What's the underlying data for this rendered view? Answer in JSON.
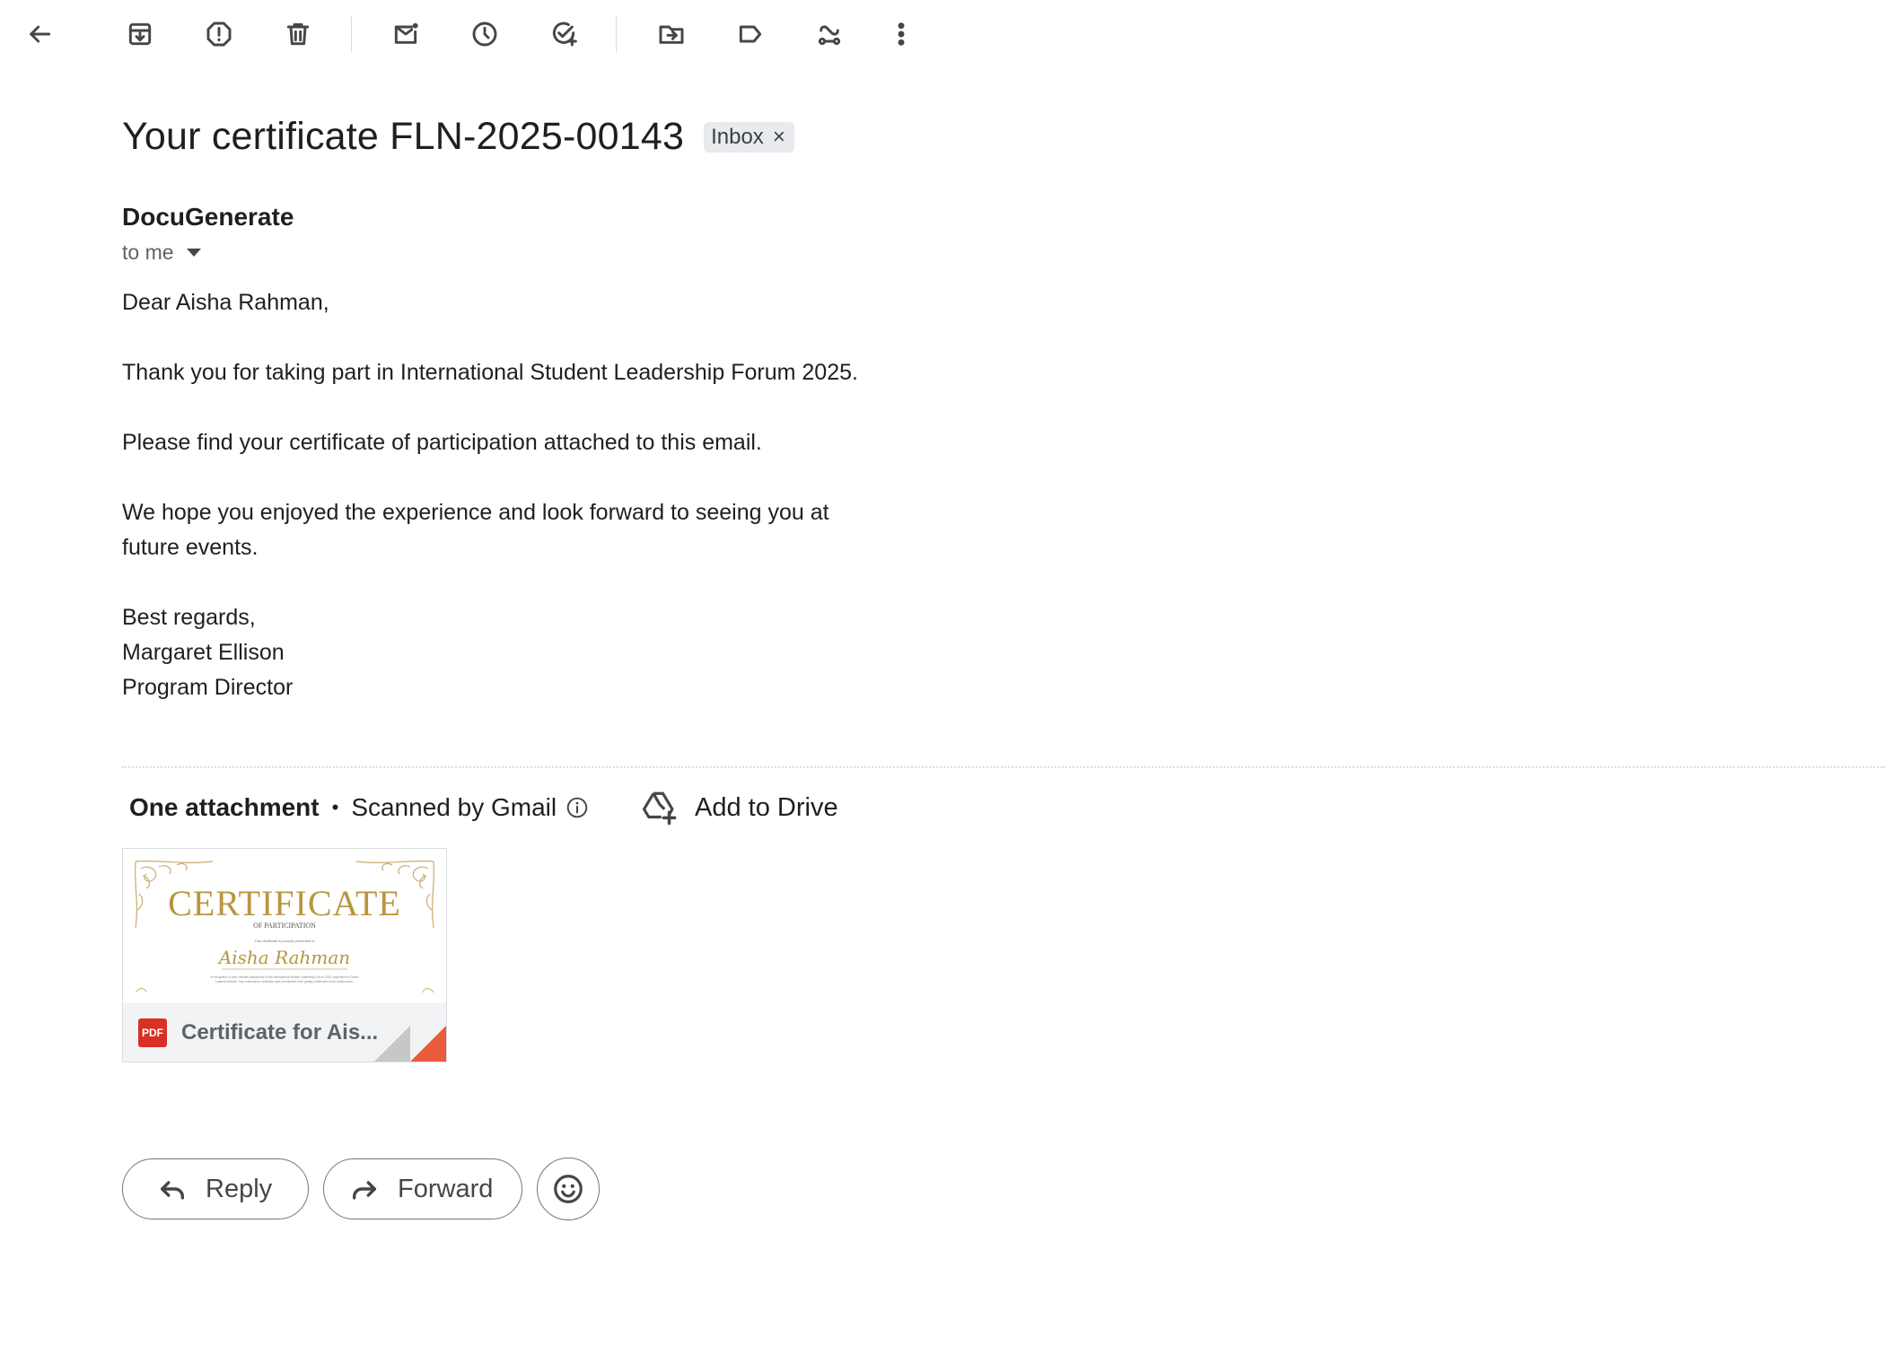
{
  "toolbar": {
    "icons": [
      "back-arrow-icon",
      "archive-icon",
      "report-spam-icon",
      "delete-icon",
      "mark-unread-icon",
      "snooze-icon",
      "add-task-icon",
      "move-to-icon",
      "label-icon",
      "create-event-icon",
      "more-vert-icon"
    ]
  },
  "email": {
    "subject": "Your certificate FLN-2025-00143",
    "label": "Inbox",
    "label_remove": "×",
    "sender": "DocuGenerate",
    "recipient": "to me",
    "body": {
      "greeting": "Dear Aisha Rahman,",
      "p1": "Thank you for taking part in International Student Leadership Forum 2025.",
      "p2": "Please find your certificate of participation attached to this email.",
      "p3": "We hope you enjoyed the experience and look forward to seeing you at future events.",
      "closing": "Best regards,",
      "signer_name": "Margaret Ellison",
      "signer_title": "Program Director"
    }
  },
  "attachments": {
    "count_label": "One attachment",
    "separator": "•",
    "scanned_label": "Scanned by Gmail",
    "add_to_drive": "Add to Drive",
    "file": {
      "name": "Certificate for Ais...",
      "type_badge": "PDF",
      "preview": {
        "heading": "CERTIFICATE",
        "subheading": "OF PARTICIPATION",
        "presented_line": "This certificate is proudly presented to",
        "recipient": "Aisha Rahman",
        "body_line1": "In recognition of your valuable participation in the International Student Leadership Forum 2025, organized for Future",
        "body_line2": "Leaders Network. Your enthusiasm, dedication and commitment have greatly contributed to the collaboration."
      }
    }
  },
  "actions": {
    "reply": "Reply",
    "forward": "Forward"
  },
  "colors": {
    "certificate_gold": "#b8963e",
    "pdf_red": "#d93025",
    "fold_orange": "#ea5a3c"
  }
}
